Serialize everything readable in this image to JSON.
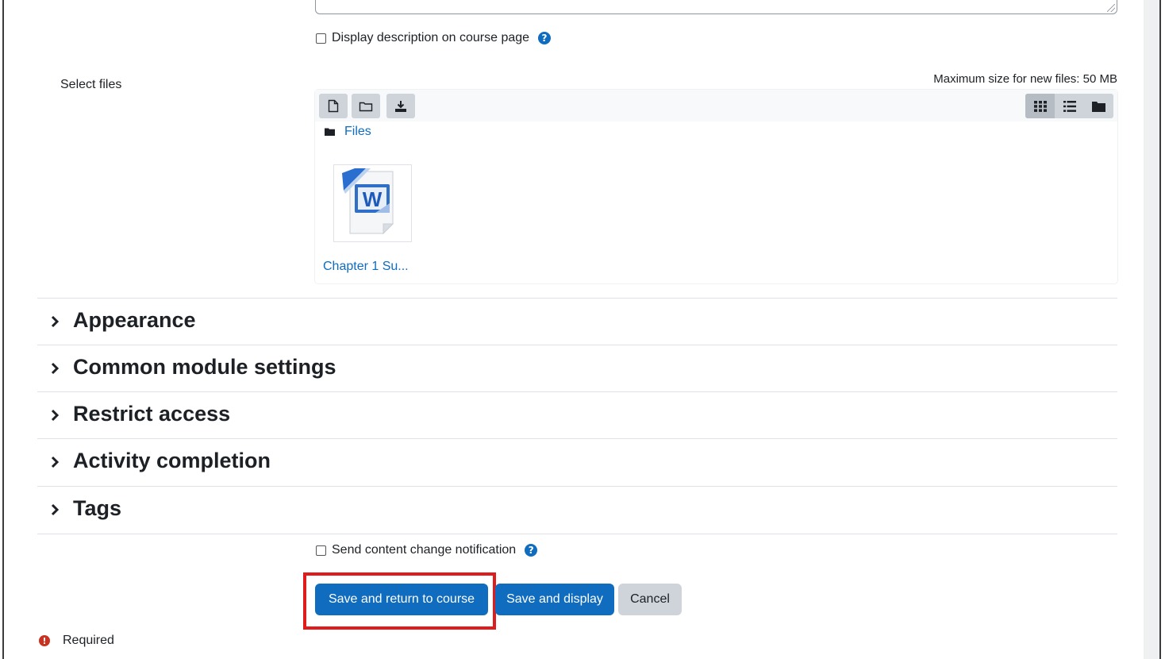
{
  "form": {
    "display_description_label": "Display description on course page",
    "select_files_label": "Select files",
    "max_size_text": "Maximum size for new files: 50 MB"
  },
  "filemanager": {
    "toolbar_icons": [
      "add-file-icon",
      "create-folder-icon",
      "download-icon"
    ],
    "view_icons": [
      "grid-view-icon",
      "list-view-icon",
      "tree-view-icon"
    ],
    "path_label": "Files",
    "file": {
      "name": "Chapter 1 Su...",
      "icon": "word-document-icon"
    }
  },
  "sections": [
    {
      "title": "Appearance"
    },
    {
      "title": "Common module settings"
    },
    {
      "title": "Restrict access"
    },
    {
      "title": "Activity completion"
    },
    {
      "title": "Tags"
    }
  ],
  "notification": {
    "label": "Send content change notification"
  },
  "buttons": {
    "save_return": "Save and return to course",
    "save_display": "Save and display",
    "cancel": "Cancel"
  },
  "required_label": "Required",
  "colors": {
    "primary": "#0f6cbf",
    "highlight": "#e01b1b",
    "required": "#ca3120"
  }
}
